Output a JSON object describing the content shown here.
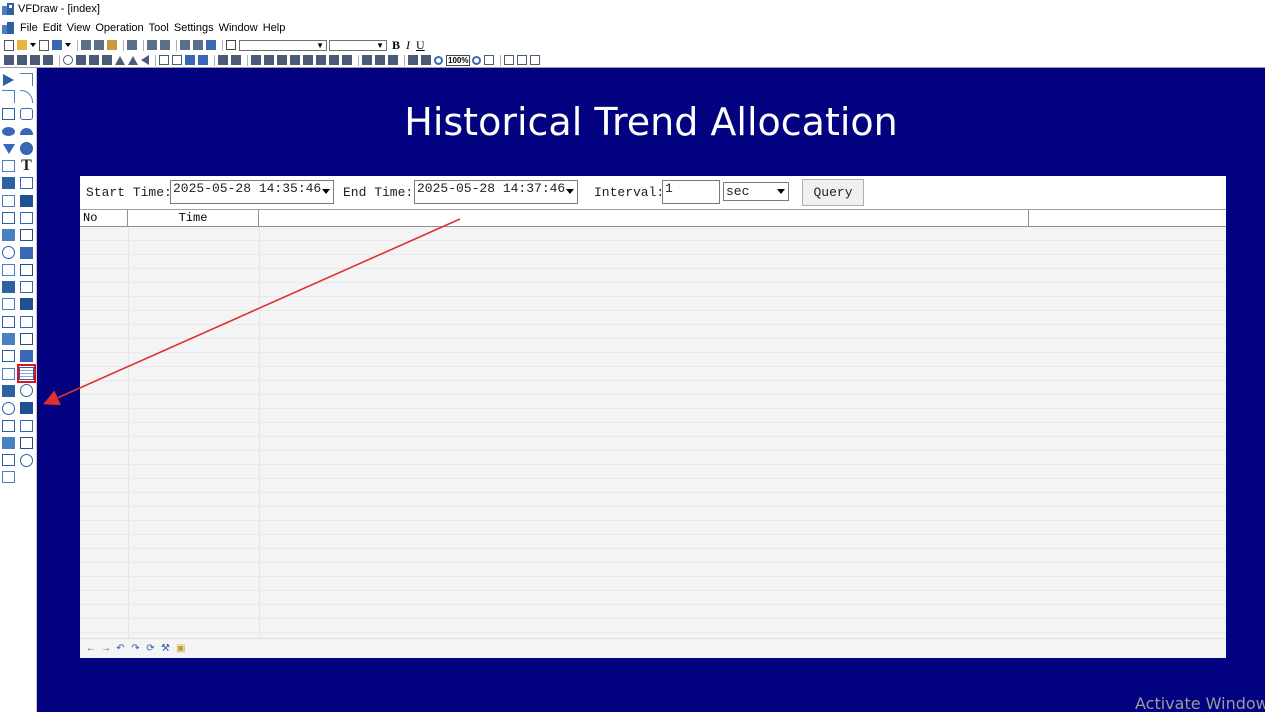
{
  "window": {
    "title": "VFDraw - [index]"
  },
  "menu": [
    "File",
    "Edit",
    "View",
    "Operation",
    "Tool",
    "Settings",
    "Window",
    "Help"
  ],
  "toolbar": {
    "format_buttons": [
      "B",
      "I",
      "U"
    ],
    "zoom": "100%"
  },
  "page": {
    "heading": "Historical Trend Allocation"
  },
  "query": {
    "start_label": "Start Time:",
    "start_value": "2025-05-28 14:35:46",
    "end_label": "End Time:",
    "end_value": "2025-05-28 14:37:46",
    "interval_label": "Interval:",
    "interval_value": "1",
    "unit_value": "sec",
    "button": "Query"
  },
  "table": {
    "columns": [
      "No",
      "Time",
      "",
      ""
    ]
  },
  "nav_icons": [
    "arrow-left-icon",
    "arrow-right-icon",
    "undo-icon",
    "redo-icon",
    "refresh-icon",
    "wrench-icon",
    "export-icon"
  ],
  "toolbox_icons": [
    "pointer-icon",
    "line-icon",
    "polyline-icon",
    "arc-icon",
    "rectangle-icon",
    "rounded-rectangle-icon",
    "ellipse-icon",
    "half-ellipse-icon",
    "triangle-icon",
    "hexagon-icon",
    "data-display-icon",
    "text-icon",
    "button-icon",
    "gear-icon",
    "grid-icon",
    "cursor-icon",
    "image-icon",
    "checkbox-icon",
    "input-field-icon",
    "list-icon",
    "clock-icon",
    "trend-icon",
    "document-icon",
    "alarm-icon",
    "alarm-bell-icon",
    "pipe-icon",
    "combobox-icon",
    "calendar-icon",
    "tree-icon",
    "chart-icon",
    "table-icon",
    "slider-icon",
    "report-icon",
    "schedule-icon",
    "camera-icon",
    "history-trend-icon",
    "gif-icon",
    "gauge-icon",
    "pie-chart-icon",
    "database-icon",
    "bar-chart-icon",
    "edit-icon",
    "clipboard-icon",
    "grid-table-icon",
    "line-chart-icon",
    "browser-icon",
    "qr-code-icon"
  ],
  "highlight": {
    "color": "#e01020",
    "target": "history-trend-icon"
  },
  "colors": {
    "canvas": "#020180",
    "accent": "#2a5caa"
  },
  "watermark": "Activate Window"
}
